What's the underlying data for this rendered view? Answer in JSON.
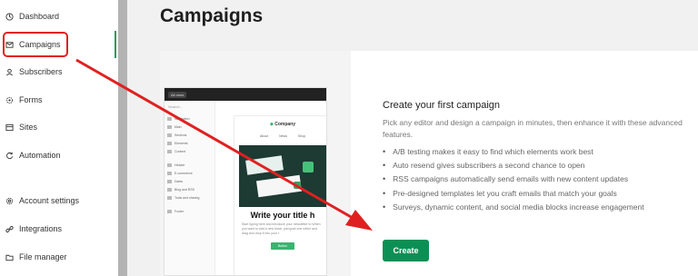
{
  "sidebar": {
    "items": [
      {
        "label": "Dashboard",
        "icon": "dashboard-icon"
      },
      {
        "label": "Campaigns",
        "icon": "mail-icon"
      },
      {
        "label": "Subscribers",
        "icon": "user-icon"
      },
      {
        "label": "Forms",
        "icon": "forms-icon"
      },
      {
        "label": "Sites",
        "icon": "sites-icon"
      },
      {
        "label": "Automation",
        "icon": "automation-icon"
      },
      {
        "label": "Account settings",
        "icon": "gear-icon"
      },
      {
        "label": "Integrations",
        "icon": "link-icon"
      },
      {
        "label": "File manager",
        "icon": "folder-icon"
      }
    ],
    "active_index": 1
  },
  "page": {
    "title": "Campaigns"
  },
  "hero": {
    "heading": "Create your first campaign",
    "description": "Pick any editor and design a campaign in minutes, then enhance it with these advanced features.",
    "features": [
      "A/B testing makes it easy to find which elements work best",
      "Auto resend gives subscribers a second chance to open",
      "RSS campaigns automatically send emails with new content updates",
      "Pre-designed templates let you craft emails that match your goals",
      "Surveys, dynamic content, and social media blocks increase engagement"
    ],
    "create_label": "Create"
  },
  "mockup": {
    "top_badge": "All done",
    "search_placeholder": "Search...",
    "sidebar_items": [
      "Navigation",
      "Main",
      "Sections",
      "Elements",
      "Content",
      "Header",
      "E-commerce",
      "Dates",
      "Blog and RSS",
      "Tools and sharing",
      "Footer"
    ],
    "company": "Company",
    "links": [
      "About",
      "News",
      "Shop"
    ],
    "heading": "Write your title h",
    "paragraph": "Start typing here and introduce your newsletter to When you want to add a new block, just grab one editor and drag and drop it into your t",
    "button": "Button"
  },
  "colors": {
    "accent_green": "#0c8f55",
    "highlight_red": "#e02020"
  }
}
